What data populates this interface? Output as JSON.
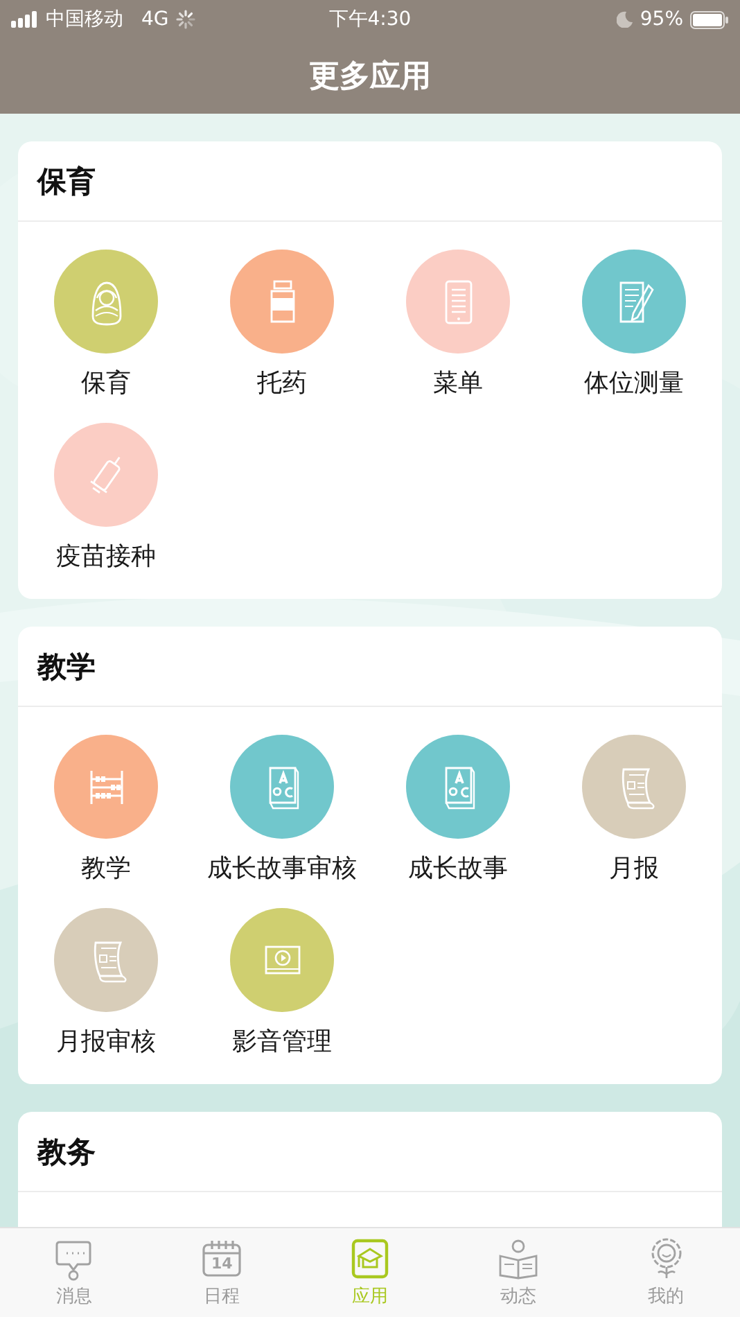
{
  "status_bar": {
    "carrier": "中国移动",
    "network": "4G",
    "time": "下午4:30",
    "battery": "95%"
  },
  "nav_bar": {
    "title": "更多应用"
  },
  "sections": [
    {
      "title": "保育",
      "apps": [
        {
          "label": "保育",
          "kind": "doll",
          "color": "#cfcf70"
        },
        {
          "label": "托药",
          "kind": "bottle",
          "color": "#f9b08a"
        },
        {
          "label": "菜单",
          "kind": "tablet",
          "color": "#fbcdc4"
        },
        {
          "label": "体位测量",
          "kind": "notepad",
          "color": "#71c7cc"
        },
        {
          "label": "疫苗接种",
          "kind": "syringe",
          "color": "#fbcdc4"
        }
      ]
    },
    {
      "title": "教学",
      "apps": [
        {
          "label": "教学",
          "kind": "abacus",
          "color": "#f9b08a"
        },
        {
          "label": "成长故事审核",
          "kind": "book",
          "color": "#71c7cc"
        },
        {
          "label": "成长故事",
          "kind": "book",
          "color": "#71c7cc"
        },
        {
          "label": "月报",
          "kind": "scroll",
          "color": "#d8cdb9"
        },
        {
          "label": "月报审核",
          "kind": "scroll",
          "color": "#d8cdb9"
        },
        {
          "label": "影音管理",
          "kind": "video",
          "color": "#cfcf70"
        }
      ]
    },
    {
      "title": "教务"
    }
  ],
  "tab_bar": [
    {
      "label": "消息",
      "kind": "chat",
      "selected": false
    },
    {
      "label": "日程",
      "kind": "calendar",
      "icon_text": "14",
      "selected": false
    },
    {
      "label": "应用",
      "kind": "cap",
      "selected": true
    },
    {
      "label": "动态",
      "kind": "reader",
      "selected": false
    },
    {
      "label": "我的",
      "kind": "flower",
      "selected": false
    }
  ]
}
